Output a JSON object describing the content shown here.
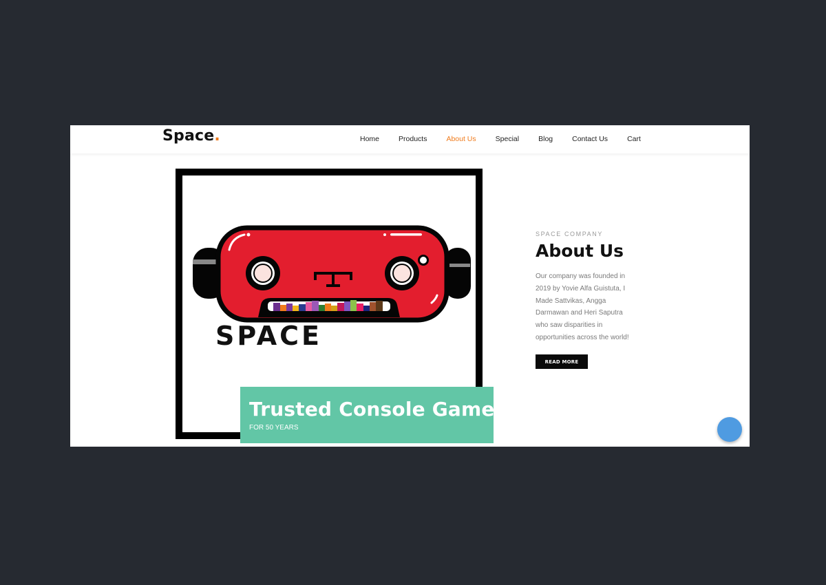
{
  "brand": {
    "name": "Space",
    "dot": "."
  },
  "nav": {
    "items": [
      {
        "label": "Home"
      },
      {
        "label": "Products"
      },
      {
        "label": "About Us",
        "active": true
      },
      {
        "label": "Special"
      },
      {
        "label": "Blog"
      },
      {
        "label": "Contact Us"
      },
      {
        "label": "Cart"
      }
    ]
  },
  "hero": {
    "logo_text": "SPACE",
    "caption_title": "Trusted Console Game",
    "caption_subtitle": "FOR 50 YEARS"
  },
  "about": {
    "eyebrow": "SPACE COMPANY",
    "title": "About Us",
    "body_lines": [
      "Our company was founded in",
      "2019 by Yovie Alfa Guistuta, I",
      "Made Sattvikas, Angga",
      "Darmawan and Heri Saputra",
      "who saw disparities in",
      "opportunities across the world!"
    ],
    "button_label": "READ MORE"
  },
  "colors": {
    "accent": "#f07b1c",
    "caption_bg": "#62c6a6",
    "robot_red": "#e31e2e",
    "fab": "#4f9be1"
  },
  "icons": {
    "robot_logo": "robot-console-logo-icon",
    "fab": "chat-bubble-icon"
  }
}
